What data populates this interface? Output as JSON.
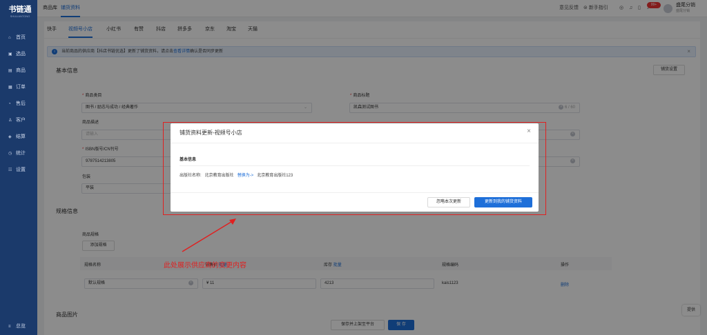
{
  "app": {
    "logo": "书链通",
    "logo_sub": "SHULIANTONG"
  },
  "sidebar": {
    "items": [
      {
        "icon": "home-icon",
        "label": "首页"
      },
      {
        "icon": "select-icon",
        "label": "选品"
      },
      {
        "icon": "goods-icon",
        "label": "商品"
      },
      {
        "icon": "order-icon",
        "label": "订单"
      },
      {
        "icon": "aftersale-icon",
        "label": "售后"
      },
      {
        "icon": "customer-icon",
        "label": "客户"
      },
      {
        "icon": "finance-icon",
        "label": "结算"
      },
      {
        "icon": "stats-icon",
        "label": "统计"
      },
      {
        "icon": "settings-icon",
        "label": "设置"
      }
    ],
    "footer": "总览"
  },
  "topbar": {
    "tabs": [
      "商品库",
      "铺货资料"
    ],
    "active_tab": "铺货资料",
    "feedback": "意见反馈",
    "guide": "新手指引",
    "badge": "99+",
    "user_name": "盛尾分销",
    "user_sub": "盛尾分销"
  },
  "platform_tabs": [
    "快手",
    "视频号小店",
    "小红书",
    "有赞",
    "抖店",
    "拼多多",
    "京东",
    "淘宝",
    "天猫"
  ],
  "active_platform": "视频号小店",
  "notice": {
    "text": "当前商品的供应商【抖店书链优选】更新了铺货资料，请点击",
    "link": "查看详情",
    "tail": "确认是否同步更新"
  },
  "basic_info": {
    "title": "基本信息",
    "settings_button": "铺货设置",
    "category_label": "商品类目",
    "category_value": "图书 / 励志与成功 / 经典著作",
    "title_label": "商品标题",
    "title_value": "凯森测试图书",
    "title_count": "6 / 60",
    "desc_label": "商品描述",
    "desc_placeholder": "请输入",
    "isbn_label": "ISBN版号/CN刊号",
    "isbn_value": "9787514213805",
    "binding_label": "包装",
    "binding_value": "平装"
  },
  "spec_info": {
    "title": "规格信息",
    "spec_label": "商品规格",
    "add_button": "添加规格",
    "columns": [
      "规格名称",
      "销售价",
      "批量",
      "库存",
      "批量",
      "规格编码",
      "操作"
    ],
    "row": {
      "name": "默认规格",
      "price": "¥ 11",
      "stock": "4213",
      "code": "kais1123",
      "action": "删除"
    }
  },
  "images": {
    "title": "商品图片"
  },
  "footer_buttons": {
    "save_shelf": "保存并上架至平台",
    "save": "保 存"
  },
  "help": "提供",
  "modal": {
    "title": "铺货资料更新-视频号小店",
    "section": "基本信息",
    "field": "出版社名称:",
    "old_value": "北京教育出版社",
    "replace": "替换为->",
    "new_value": "北京教育出版社123",
    "ignore_button": "忽略本次更新",
    "update_button": "更新到我的铺货资料"
  },
  "annotation": "此处展示供应商的变更内容",
  "colors": {
    "primary": "#1e6fd9",
    "sidebar": "#1b3a6b",
    "annotation": "#e02020"
  }
}
